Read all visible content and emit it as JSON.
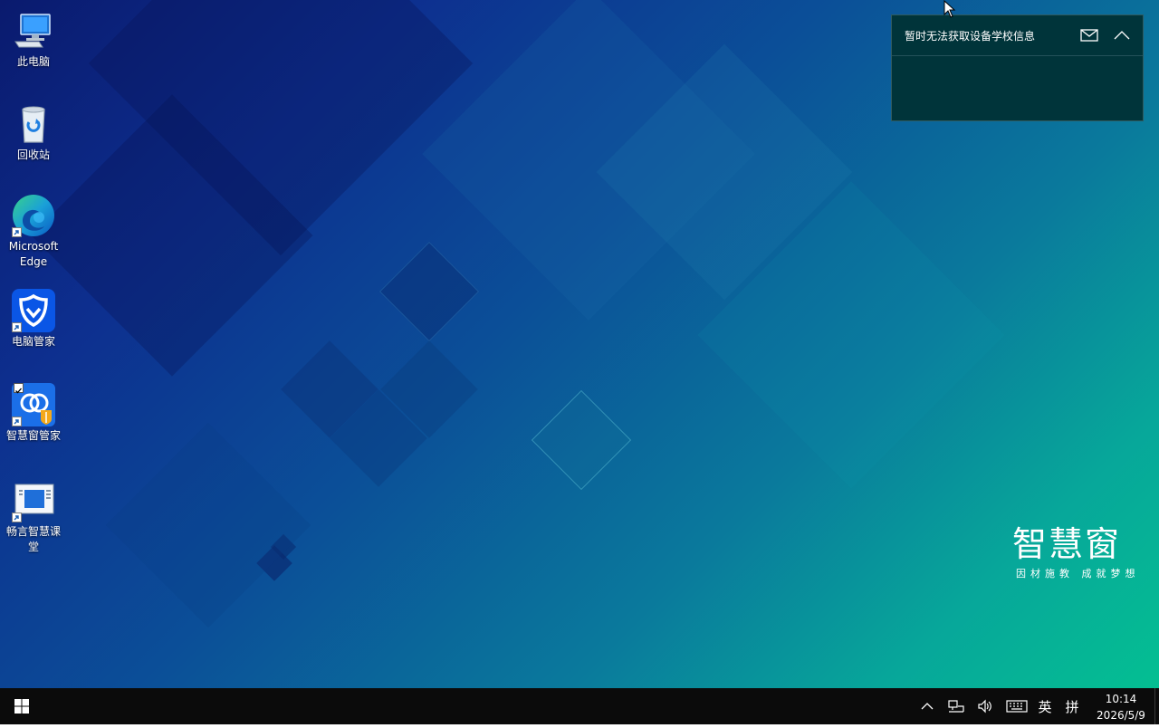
{
  "desktop": {
    "icons": [
      {
        "label": "此电脑",
        "icon": "computer-icon"
      },
      {
        "label": "回收站",
        "icon": "recycle-bin-icon"
      },
      {
        "label": "Microsoft\nEdge",
        "label_line1": "Microsoft",
        "label_line2": "Edge",
        "icon": "edge-icon"
      },
      {
        "label": "电脑管家",
        "icon": "pc-manager-icon"
      },
      {
        "label": "智慧窗管家",
        "icon": "smart-window-manager-icon"
      },
      {
        "label": "畅言智慧课堂",
        "label_line1": "畅言智慧课",
        "label_line2": "堂",
        "icon": "smart-classroom-icon"
      }
    ]
  },
  "notification": {
    "title": "暂时无法获取设备学校信息",
    "mail_icon": "mail-icon",
    "collapse_icon": "chevron-up-icon"
  },
  "brand": {
    "main": "智慧窗",
    "sub": "因材施教 成就梦想"
  },
  "taskbar": {
    "start_icon": "windows-logo-icon",
    "tray": {
      "overflow_icon": "chevron-up-icon",
      "network_icon": "network-icon",
      "volume_icon": "volume-icon",
      "keyboard_icon": "keyboard-icon",
      "ime_language": "英",
      "ime_mode": "拼"
    },
    "clock": {
      "time": "10:14",
      "date": "2026/5/9"
    }
  },
  "colors": {
    "taskbar_bg": "#0b0b0b",
    "notification_bg": "#00343a",
    "gradient_start": "#0a1a6e",
    "gradient_end": "#04bf92"
  }
}
